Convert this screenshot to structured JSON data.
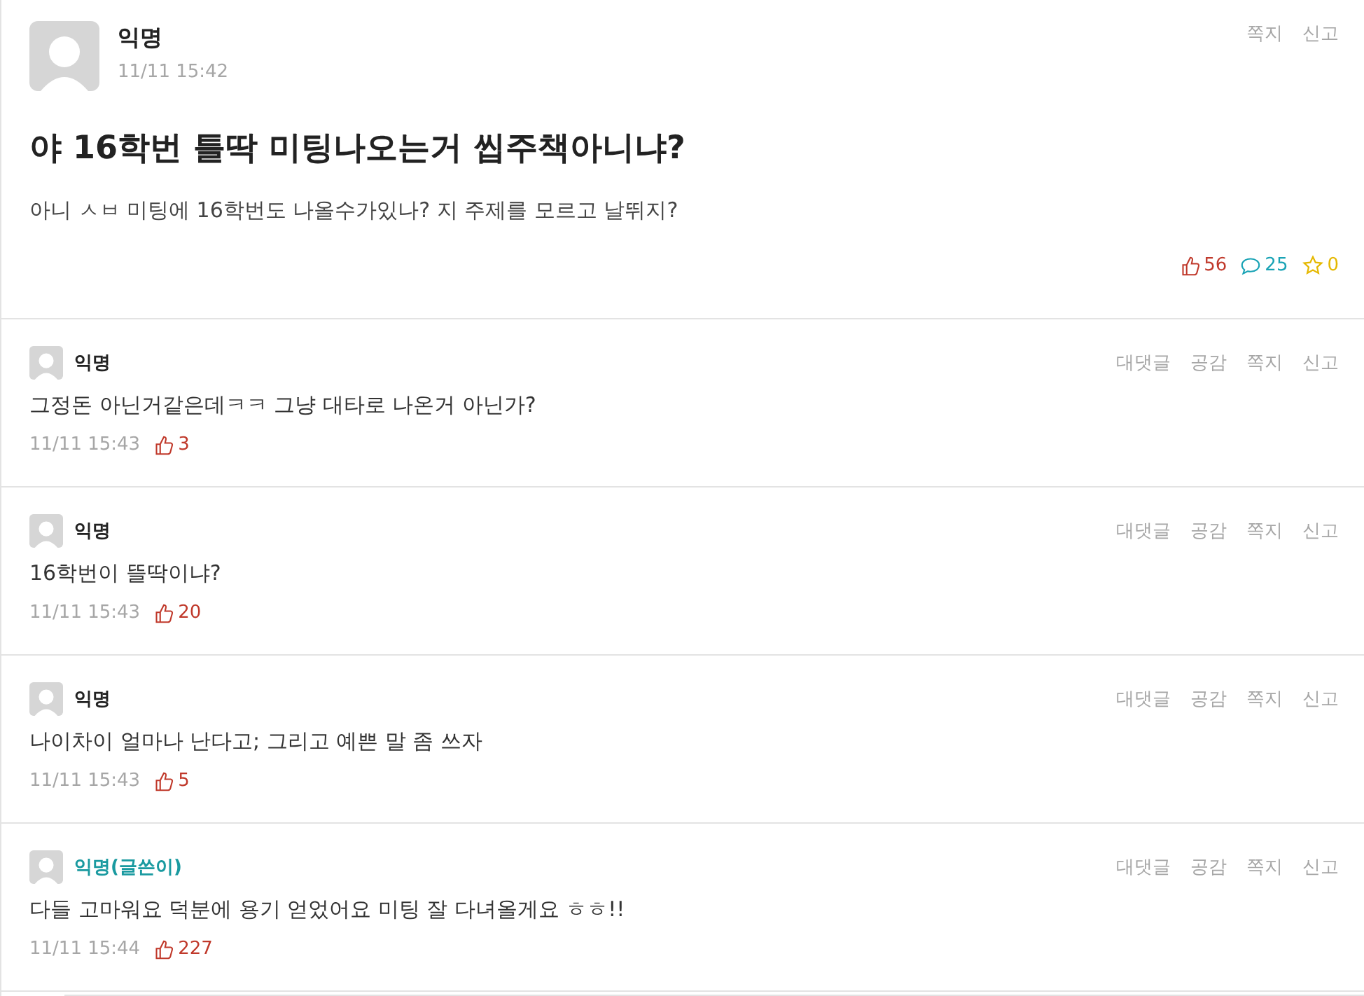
{
  "post": {
    "author": "익명",
    "time": "11/11 15:42",
    "actions": [
      "쪽지",
      "신고"
    ],
    "title": "야 16학번 틀딱 미팅나오는거 씹주책아니냐?",
    "body": "아니 ㅅㅂ 미팅에 16학번도 나올수가있나? 지 주제를 모르고 날뛰지?",
    "likes": "56",
    "comments": "25",
    "scraps": "0"
  },
  "comments": [
    {
      "author": "익명",
      "is_writer": false,
      "actions": [
        "대댓글",
        "공감",
        "쪽지",
        "신고"
      ],
      "text": "그정돈 아닌거같은데ㅋㅋ 그냥 대타로 나온거 아닌가?",
      "time": "11/11 15:43",
      "likes": "3"
    },
    {
      "author": "익명",
      "is_writer": false,
      "actions": [
        "대댓글",
        "공감",
        "쪽지",
        "신고"
      ],
      "text": "16학번이 뜰딱이냐?",
      "time": "11/11 15:43",
      "likes": "20"
    },
    {
      "author": "익명",
      "is_writer": false,
      "actions": [
        "대댓글",
        "공감",
        "쪽지",
        "신고"
      ],
      "text": "나이차이 얼마나 난다고; 그리고 예쁜 말 좀 쓰자",
      "time": "11/11 15:43",
      "likes": "5"
    },
    {
      "author": "익명(글쓴이)",
      "is_writer": true,
      "actions": [
        "대댓글",
        "공감",
        "쪽지",
        "신고"
      ],
      "text": "다들 고마워요 덕분에 용기 얻었어요 미팅 잘 다녀올게요 ㅎㅎ!!",
      "time": "11/11 15:44",
      "likes": "227"
    }
  ]
}
